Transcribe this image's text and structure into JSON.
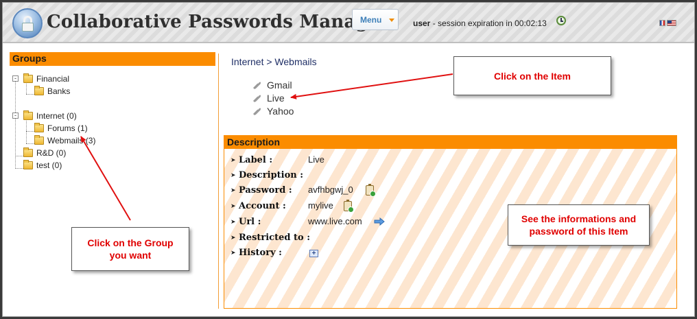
{
  "header": {
    "title": "Collaborative Passwords Manager",
    "menu_label": "Menu",
    "user": "user",
    "session_text": "- session expiration in 00:02:13",
    "icons": [
      "lock-logo-icon",
      "clock-icon",
      "flag-fr-icon",
      "flag-us-icon"
    ]
  },
  "groups": {
    "title": "Groups",
    "tree": [
      {
        "label": "Financial",
        "level": 0,
        "toggle": "-"
      },
      {
        "label": "Banks",
        "level": 1
      },
      {
        "label": "Internet (0)",
        "level": 0,
        "toggle": "-"
      },
      {
        "label": "Forums (1)",
        "level": 1
      },
      {
        "label": "Webmails (3)",
        "level": 1
      },
      {
        "label": "R&D (0)",
        "level": 0
      },
      {
        "label": "test (0)",
        "level": 0
      }
    ]
  },
  "breadcrumb": "Internet > Webmails",
  "items": [
    "Gmail",
    "Live",
    "Yahoo"
  ],
  "description": {
    "title": "Description",
    "fields": {
      "label": {
        "name": "Label :",
        "value": "Live"
      },
      "description": {
        "name": "Description :",
        "value": ""
      },
      "password": {
        "name": "Password :",
        "value": "avfhbgwj_0"
      },
      "account": {
        "name": "Account :",
        "value": "mylive"
      },
      "url": {
        "name": "Url :",
        "value": "www.live.com"
      },
      "restricted": {
        "name": "Restricted to :",
        "value": ""
      },
      "history": {
        "name": "History :",
        "value": ""
      }
    }
  },
  "callouts": {
    "item": "Click on the Item",
    "group": "Click on the Group\nyou want",
    "info": "See the informations and\npassword of this Item"
  },
  "colors": {
    "accent": "#fb8c00",
    "callout_text": "#e00000",
    "arrow": "#e01010"
  }
}
